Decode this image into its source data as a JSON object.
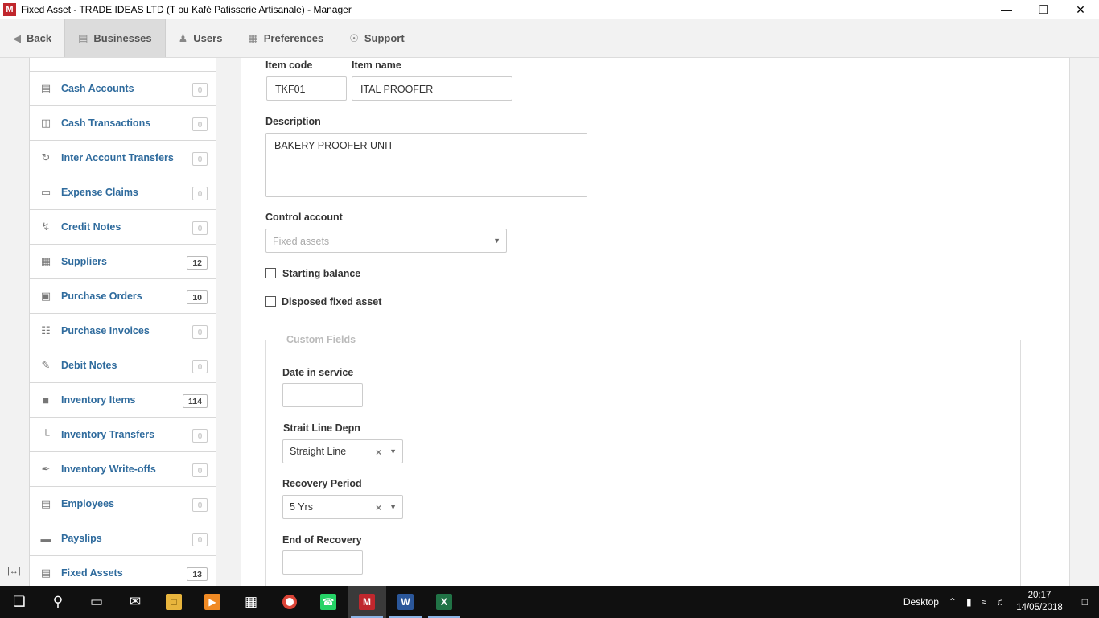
{
  "window": {
    "title": "Fixed Asset - TRADE IDEAS LTD (T ou Kafé Patisserie Artisanale) - Manager",
    "app_logo": "M"
  },
  "toolbar": {
    "back": "Back",
    "businesses": "Businesses",
    "users": "Users",
    "preferences": "Preferences",
    "support": "Support"
  },
  "sidebar": {
    "items": [
      {
        "label": "Cash Accounts",
        "count": "0",
        "icon": "bank-icon"
      },
      {
        "label": "Cash Transactions",
        "count": "0",
        "icon": "cash-register-icon"
      },
      {
        "label": "Inter Account Transfers",
        "count": "0",
        "icon": "transfer-icon"
      },
      {
        "label": "Expense Claims",
        "count": "0",
        "icon": "wallet-icon"
      },
      {
        "label": "Credit Notes",
        "count": "0",
        "icon": "lightning-icon"
      },
      {
        "label": "Suppliers",
        "count": "12",
        "icon": "building-icon"
      },
      {
        "label": "Purchase Orders",
        "count": "10",
        "icon": "cart-icon"
      },
      {
        "label": "Purchase Invoices",
        "count": "0",
        "icon": "calendar-icon"
      },
      {
        "label": "Debit Notes",
        "count": "0",
        "icon": "edit-icon"
      },
      {
        "label": "Inventory Items",
        "count": "114",
        "icon": "box-icon"
      },
      {
        "label": "Inventory Transfers",
        "count": "0",
        "icon": "forklift-icon"
      },
      {
        "label": "Inventory Write-offs",
        "count": "0",
        "icon": "pen-icon"
      },
      {
        "label": "Employees",
        "count": "0",
        "icon": "id-card-icon"
      },
      {
        "label": "Payslips",
        "count": "0",
        "icon": "money-icon"
      },
      {
        "label": "Fixed Assets",
        "count": "13",
        "icon": "list-icon"
      }
    ]
  },
  "form": {
    "item_code_label": "Item code",
    "item_code_value": "TKF01",
    "item_name_label": "Item name",
    "item_name_value": "ITAL PROOFER",
    "description_label": "Description",
    "description_value": "BAKERY PROOFER UNIT",
    "control_account_label": "Control account",
    "control_account_placeholder": "Fixed assets",
    "starting_balance_label": "Starting balance",
    "disposed_label": "Disposed fixed asset",
    "custom_fields_legend": "Custom Fields",
    "date_in_service_label": "Date in service",
    "date_in_service_value": "",
    "strait_line_label": "Strait Line Depn",
    "strait_line_value": "Straight Line",
    "recovery_period_label": "Recovery Period",
    "recovery_period_value": "5 Yrs",
    "end_of_recovery_label": "End of Recovery",
    "end_of_recovery_value": ""
  },
  "taskbar": {
    "desktop_label": "Desktop",
    "time": "20:17",
    "date": "14/05/2018"
  }
}
